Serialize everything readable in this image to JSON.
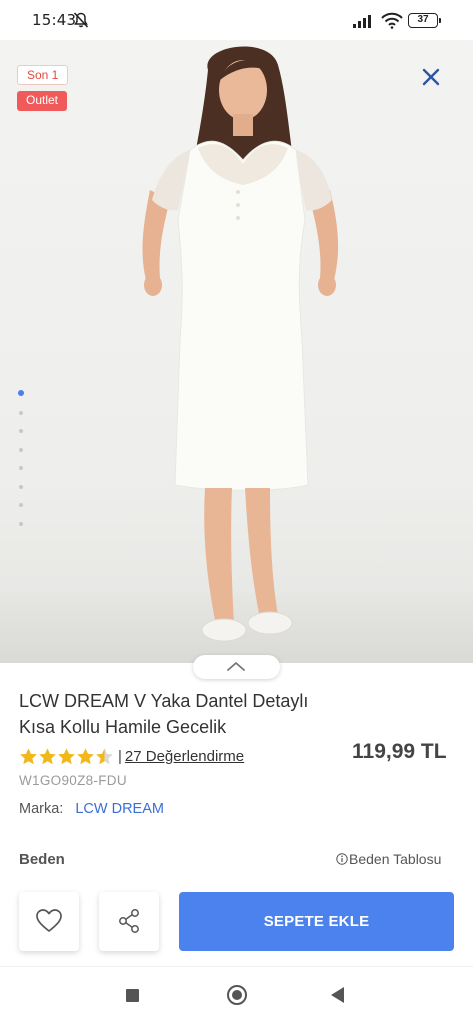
{
  "status_bar": {
    "time": "15:43",
    "battery": "37",
    "icons": [
      "mute-icon",
      "signal-icon",
      "wifi-icon",
      "battery-icon"
    ]
  },
  "gallery": {
    "badges": {
      "last": "Son 1",
      "outlet": "Outlet"
    },
    "image_count": 8,
    "active_index": 0,
    "icons": [
      "close-icon",
      "chevron-up-icon"
    ]
  },
  "product": {
    "title": "LCW DREAM V Yaka Dantel Detaylı Kısa Kollu Hamile Gecelik",
    "rating_value": 4.5,
    "rating_separator": "|",
    "reviews_link": "27 Değerlendirme",
    "price": "119,99 TL",
    "sku": "W1GO90Z8-FDU",
    "brand_label": "Marka:",
    "brand_value": "LCW DREAM"
  },
  "size": {
    "label": "Beden",
    "chart_link": "Beden Tablosu"
  },
  "actions": {
    "add_to_cart": "SEPETE EKLE",
    "icons": [
      "heart-icon",
      "share-icon"
    ]
  },
  "colors": {
    "accent": "#4b82ee",
    "badge_red": "#f05a5a",
    "star": "#f2b81b",
    "link_blue": "#3b6fd6"
  }
}
